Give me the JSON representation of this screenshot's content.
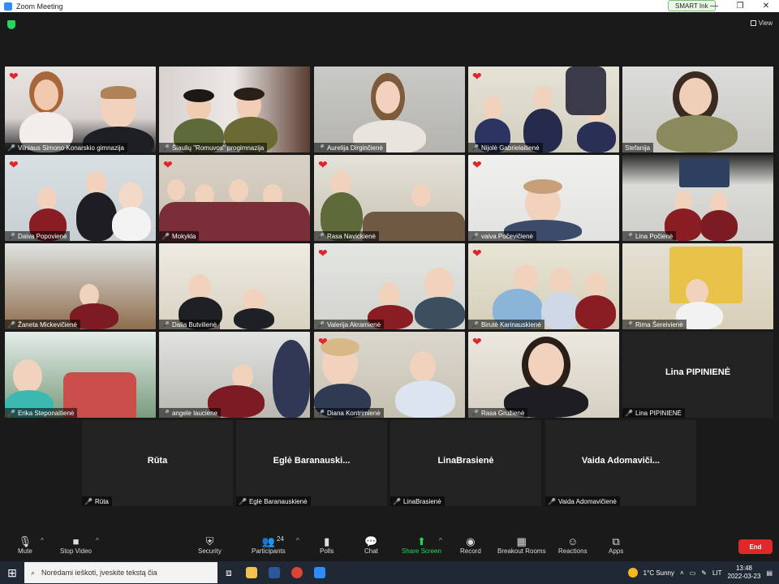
{
  "window": {
    "title": "Zoom Meeting",
    "smart_ink": "SMART Ink",
    "minimize": "—",
    "restore": "❐",
    "close": "✕"
  },
  "topbar": {
    "view_label": "View"
  },
  "tiles": [
    {
      "name": "Vilniaus Simono Konarskio gimnazija",
      "heart": true
    },
    {
      "name": "Šiaulių \"Romuvos\" progimnazija",
      "heart": false
    },
    {
      "name": "Aurelija Dirginčienė",
      "heart": false
    },
    {
      "name": "Nijolė Gabrielaitienė",
      "heart": true
    },
    {
      "name": "Stefanija",
      "heart": false
    },
    {
      "name": "Daiva Popovienė",
      "heart": true
    },
    {
      "name": "Mokykla",
      "heart": true
    },
    {
      "name": "Rasa Navickienė",
      "heart": true
    },
    {
      "name": "vaiva Počevičienė",
      "heart": true
    },
    {
      "name": "Lina Počienė",
      "heart": false
    },
    {
      "name": "Žaneta Mickevičienė",
      "heart": false
    },
    {
      "name": "Dalia Butvilienė",
      "heart": false
    },
    {
      "name": "Valerija Akramienė",
      "heart": true
    },
    {
      "name": "Birutė Karinauskienė",
      "heart": true
    },
    {
      "name": "Rima Šereivienė",
      "heart": false
    },
    {
      "name": "Erika Steponaitienė",
      "heart": false
    },
    {
      "name": "angele lauciene",
      "heart": false
    },
    {
      "name": "Diana Kontrimienė",
      "heart": true
    },
    {
      "name": "Rasa Gružienė",
      "heart": true
    },
    {
      "name": "Lina PIPINIENĖ",
      "heart": false,
      "big": "Lina PIPINIENĖ"
    }
  ],
  "bottom_tiles": [
    {
      "big": "Rūta",
      "name": "Rūta"
    },
    {
      "big": "Eglė Baranauski...",
      "name": "Eglė Baranauskienė"
    },
    {
      "big": "LinaBrasienė",
      "name": "LinaBrasienė"
    },
    {
      "big": "Vaida Adomaviči...",
      "name": "Vaida Adomavičienė"
    }
  ],
  "toolbar": {
    "mute": "Mute",
    "stop_video": "Stop Video",
    "security": "Security",
    "participants": "Participants",
    "participants_count": "24",
    "polls": "Polls",
    "chat": "Chat",
    "share_screen": "Share Screen",
    "record": "Record",
    "breakout": "Breakout Rooms",
    "reactions": "Reactions",
    "apps": "Apps",
    "end": "End"
  },
  "taskbar": {
    "search_placeholder": "Norėdami ieškoti, įveskite tekstą čia",
    "weather": "1°C Sunny",
    "lang": "LIT",
    "time": "13:48",
    "date": "2022-03-23"
  },
  "colors": {
    "heart": "#e0252e",
    "accent_green": "#23d959",
    "end_red": "#e02828",
    "active_border": "#d4e84a"
  }
}
